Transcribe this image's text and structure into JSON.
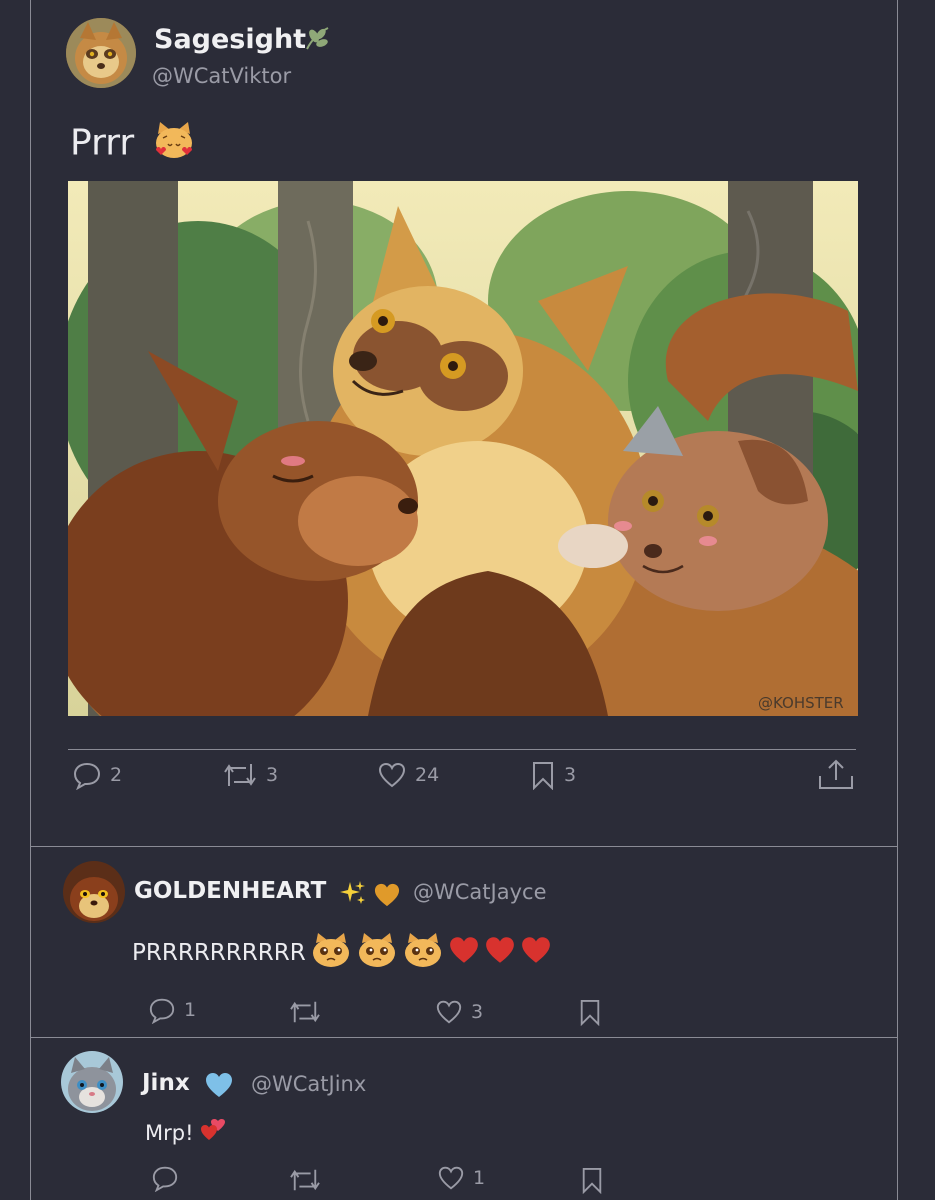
{
  "main_post": {
    "display_name": "Sagesight",
    "name_badge_icon": "leaf-icon",
    "handle": "@WCatViktor",
    "text": "Prrr",
    "text_emoji": "heart-eyes-cat",
    "image": {
      "signature": "@KOHSTER",
      "description_icon": "forest-cats-illustration"
    },
    "actions": {
      "replies": "2",
      "retweets": "3",
      "likes": "24",
      "bookmarks": "3"
    }
  },
  "replies": [
    {
      "display_name": "GOLDENHEART",
      "badges": [
        "sparkles-icon",
        "orange-heart-icon"
      ],
      "handle": "@WCatJayce",
      "text": "PRRRRRRRRRR",
      "text_emojis": [
        "pleading-cat",
        "pleading-cat",
        "pleading-cat",
        "red-heart",
        "red-heart",
        "red-heart"
      ],
      "actions": {
        "replies": "1",
        "retweets": "",
        "likes": "3"
      }
    },
    {
      "display_name": "Jinx",
      "badges": [
        "light-blue-heart-icon"
      ],
      "handle": "@WCatJinx",
      "text": "Mrp!",
      "text_emojis": [
        "two-hearts"
      ],
      "actions": {
        "replies": "",
        "retweets": "",
        "likes": "1"
      }
    }
  ],
  "colors": {
    "background": "#2b2c38",
    "border": "#8a8b95",
    "muted": "#9a9ba6",
    "text": "#ececf0",
    "heart_red": "#d8322e",
    "heart_orange": "#e09a2a",
    "heart_blue": "#7ec0e8"
  }
}
